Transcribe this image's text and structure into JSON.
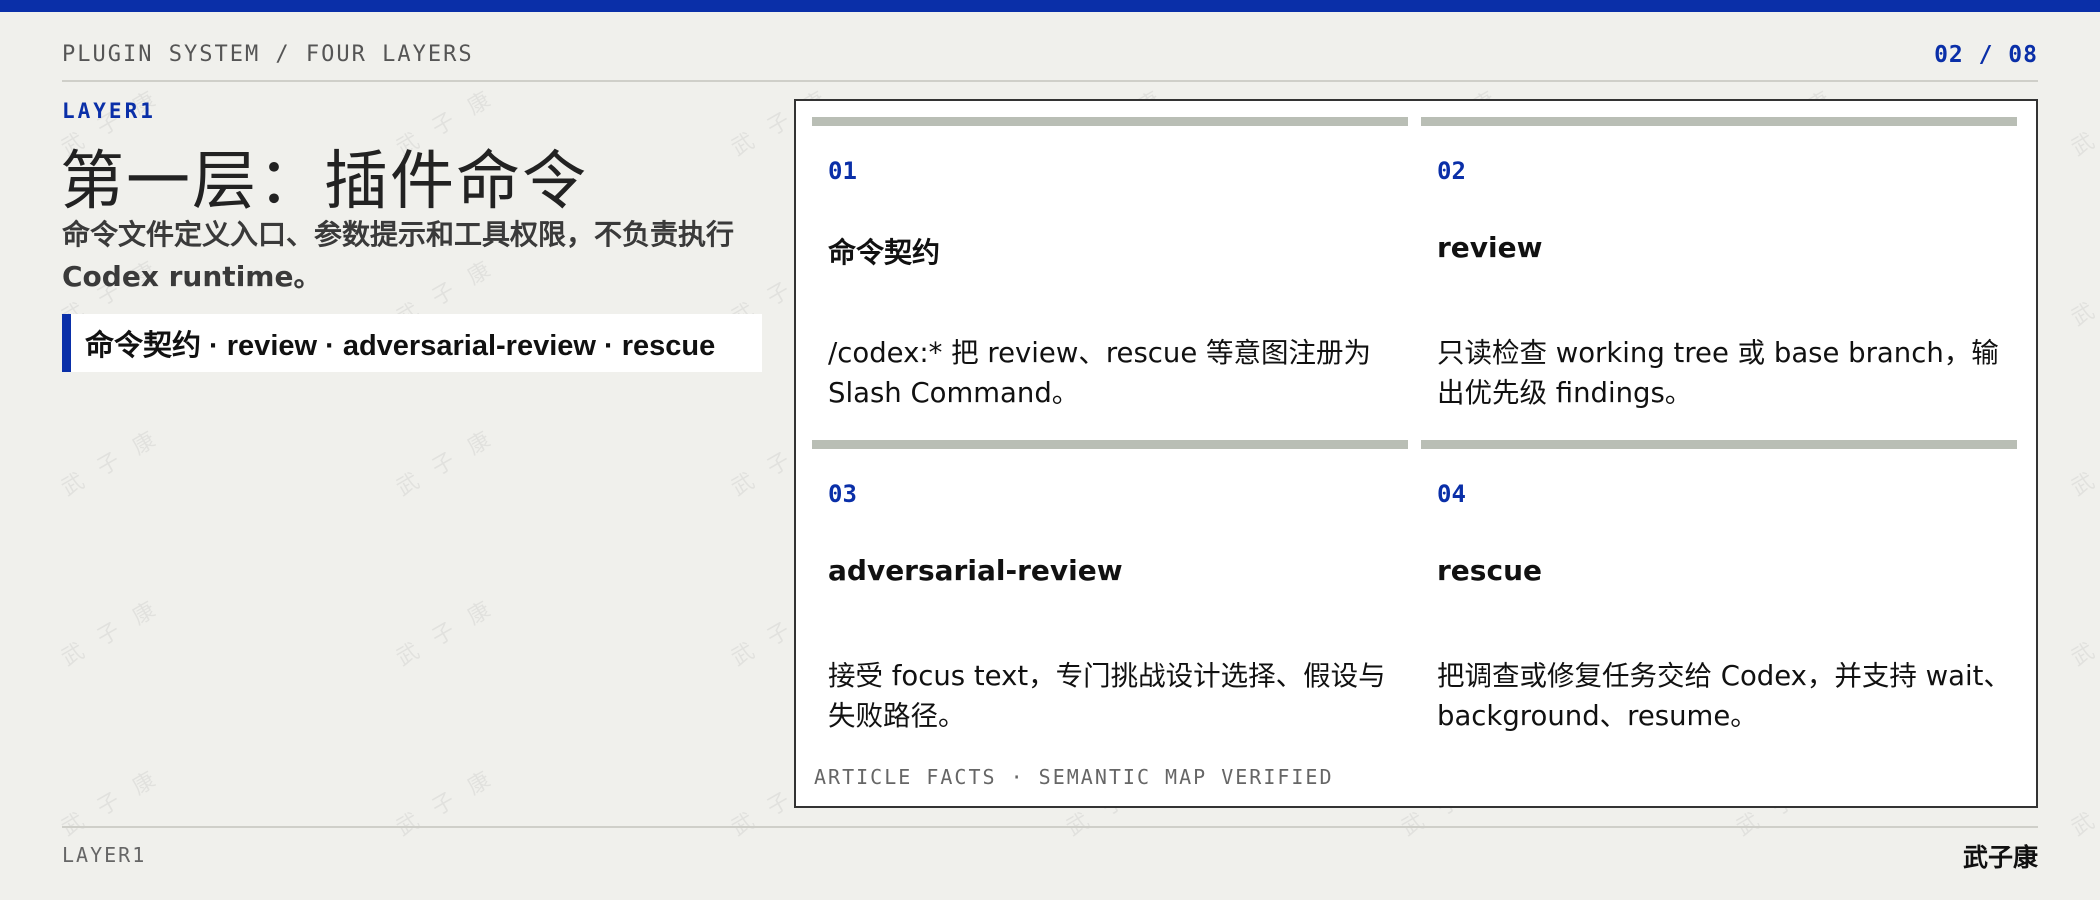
{
  "header": {
    "section_label": "PLUGIN SYSTEM / FOUR LAYERS",
    "page_counter": "02 / 08"
  },
  "intro": {
    "eyebrow": "LAYER1",
    "title": "第一层：插件命令",
    "subtitle": "命令文件定义入口、参数提示和工具权限，不负责执行 Codex runtime。",
    "command_strip": "命令契约 · review · adversarial-review · rescue"
  },
  "cards": [
    {
      "num": "01",
      "name": "命令契约",
      "desc": "/codex:* 把 review、rescue 等意图注册为 Slash Command。"
    },
    {
      "num": "02",
      "name": "review",
      "desc": "只读检查 working tree 或 base branch，输出优先级 findings。"
    },
    {
      "num": "03",
      "name": "adversarial-review",
      "desc": "接受 focus text，专门挑战设计选择、假设与失败路径。"
    },
    {
      "num": "04",
      "name": "rescue",
      "desc": "把调查或修复任务交给 Codex，并支持 wait、background、resume。"
    }
  ],
  "panel": {
    "footer": "ARTICLE FACTS · SEMANTIC MAP VERIFIED"
  },
  "footer": {
    "left": "LAYER1",
    "author": "武子康"
  },
  "watermark_text": "武 子 康",
  "colors": {
    "accent": "#0a2fa8",
    "background": "#f0f0ec",
    "card_bar": "#b9beb5"
  }
}
